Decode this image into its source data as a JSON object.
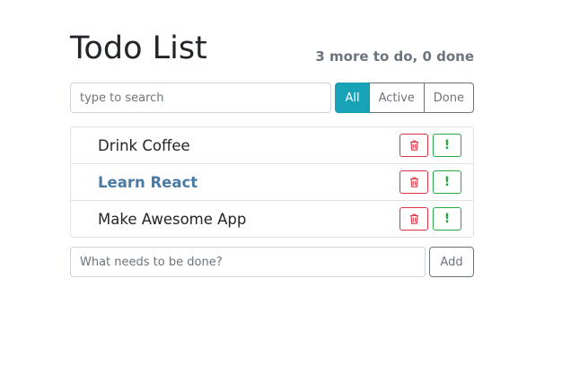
{
  "app": {
    "title": "Todo List",
    "counter": "3 more to do, 0 done"
  },
  "search": {
    "placeholder": "type to search",
    "value": ""
  },
  "filters": [
    {
      "label": "All",
      "active": true
    },
    {
      "label": "Active",
      "active": false
    },
    {
      "label": "Done",
      "active": false
    }
  ],
  "todos": [
    {
      "label": "Drink Coffee",
      "important": false,
      "done": false
    },
    {
      "label": "Learn React",
      "important": true,
      "done": false
    },
    {
      "label": "Make Awesome App",
      "important": false,
      "done": false
    }
  ],
  "item_buttons": {
    "delete_icon": "trash-icon",
    "important_icon": "exclamation-icon",
    "important_glyph": "!"
  },
  "add_form": {
    "placeholder": "What needs to be done?",
    "value": "",
    "button_label": "Add"
  },
  "colors": {
    "accent": "#17a2b8",
    "danger": "#dc3545",
    "success": "#28a745",
    "important_text": "#4a7ba7",
    "muted": "#6c757d"
  }
}
